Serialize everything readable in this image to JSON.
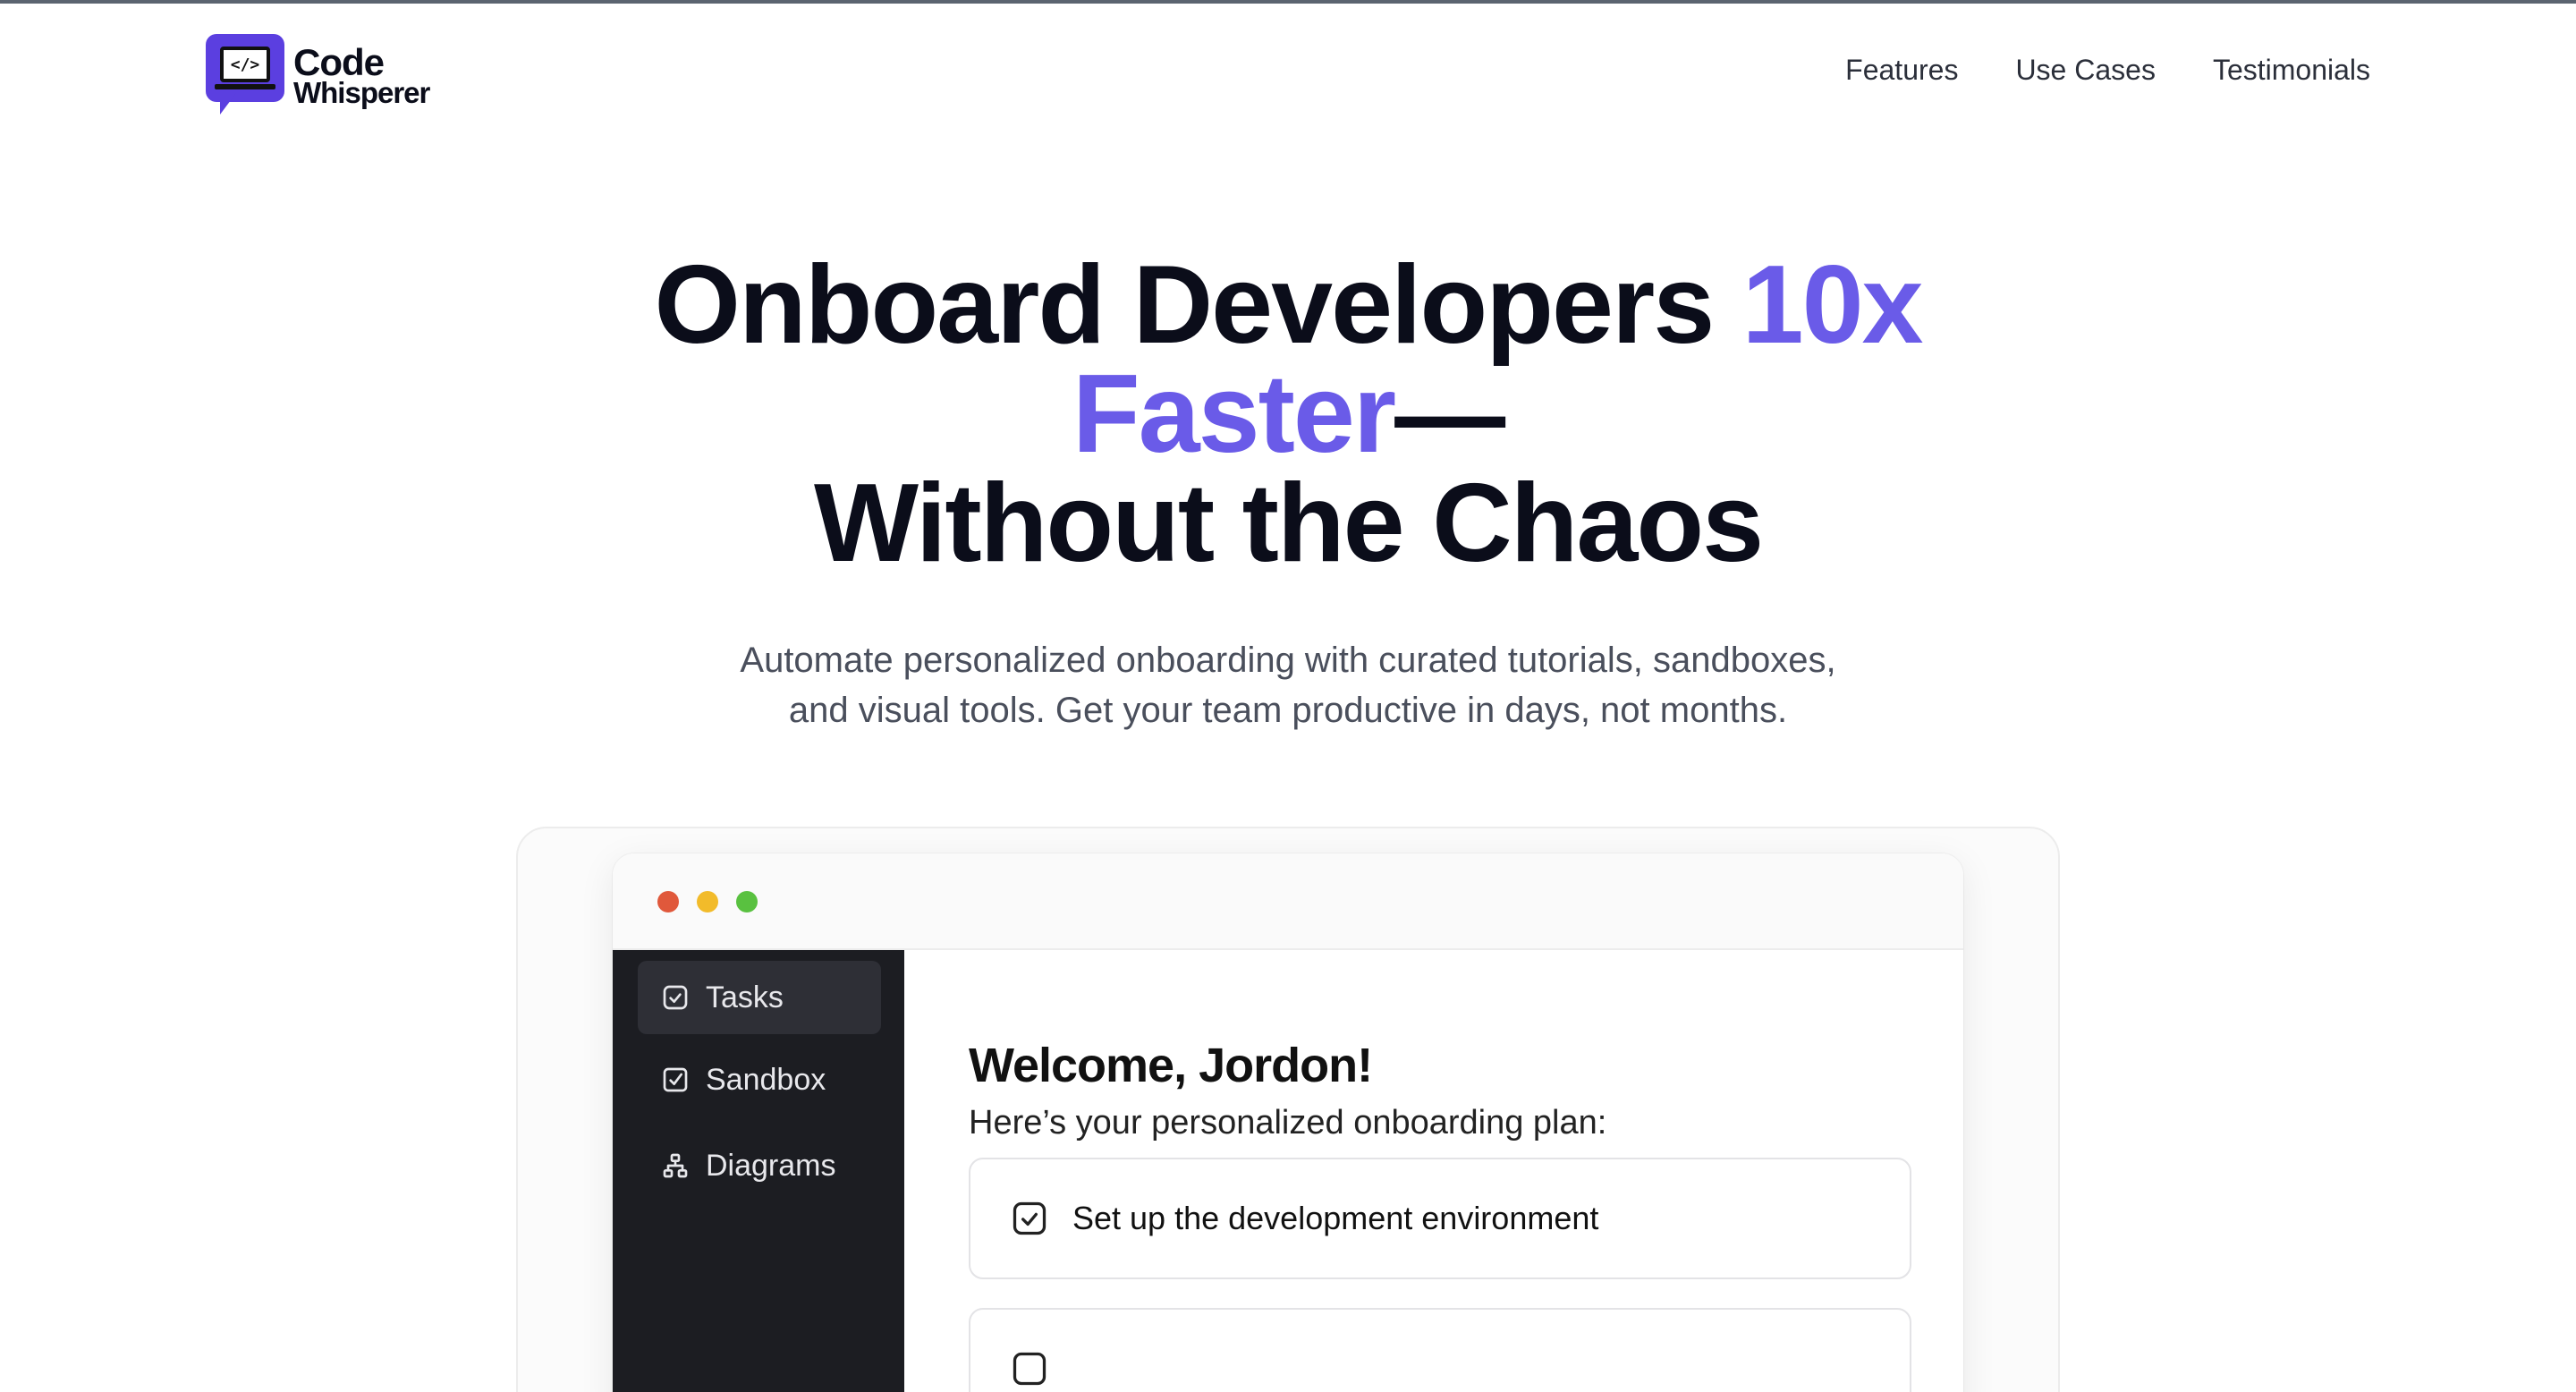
{
  "header": {
    "logo": {
      "line1": "Code",
      "line2": "Whisperer",
      "icon": "code-laptop-chat-icon",
      "brand_color": "#5b3fe0"
    },
    "nav": [
      {
        "label": "Features"
      },
      {
        "label": "Use Cases"
      },
      {
        "label": "Testimonials"
      }
    ]
  },
  "hero": {
    "title_part1": "Onboard Developers ",
    "title_accent1": "10x",
    "title_accent2": "Faster",
    "title_dash": "—",
    "title_line3": "Without the Chaos",
    "accent_color": "#6a5be8",
    "subtitle_line1": "Automate personalized onboarding with curated tutorials, sandboxes,",
    "subtitle_line2": "and visual tools. Get your team productive in days, not months."
  },
  "app_preview": {
    "window_controls": [
      "close-dot",
      "minimize-dot",
      "maximize-dot"
    ],
    "sidebar": {
      "items": [
        {
          "label": "Tasks",
          "icon": "checkbox-icon",
          "active": true
        },
        {
          "label": "Sandbox",
          "icon": "checkbox-icon",
          "active": false
        },
        {
          "label": "Diagrams",
          "icon": "hierarchy-icon",
          "active": false
        }
      ]
    },
    "main": {
      "welcome": "Welcome, Jordon!",
      "subtitle": "Here’s your personalized onboarding plan:",
      "tasks": [
        {
          "label": "Set up the development environment",
          "icon": "checkbox-icon"
        },
        {
          "label": "",
          "icon": "checkbox-icon"
        }
      ]
    }
  }
}
